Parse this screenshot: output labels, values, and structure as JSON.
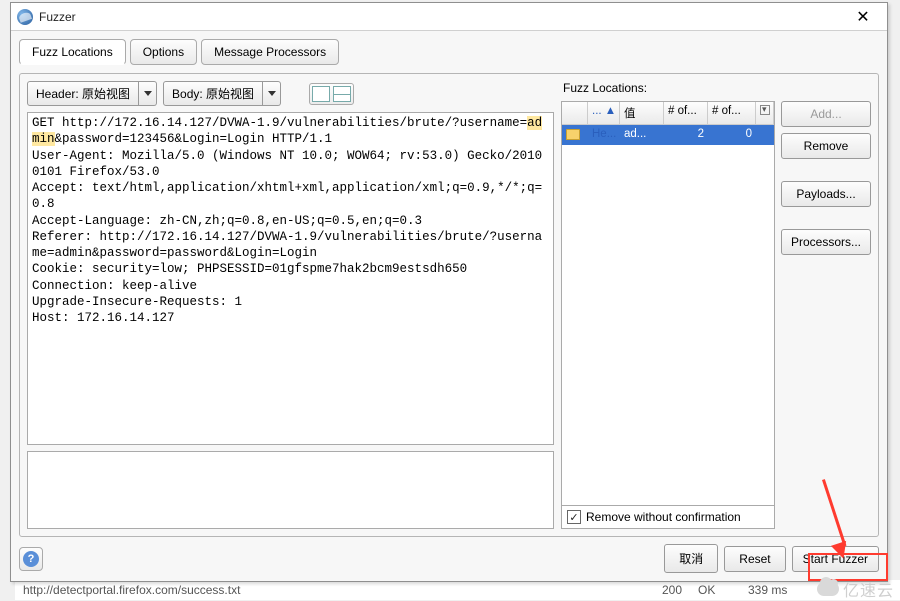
{
  "window": {
    "title": "Fuzzer",
    "close_glyph": "✕"
  },
  "tabs": [
    {
      "id": "fuzz-locations",
      "label": "Fuzz Locations",
      "active": true
    },
    {
      "id": "options",
      "label": "Options",
      "active": false
    },
    {
      "id": "message-processors",
      "label": "Message Processors",
      "active": false
    }
  ],
  "view_bar": {
    "header_label": "Header: 原始视图",
    "body_label": "Body: 原始视图"
  },
  "request": {
    "line1": "GET http://172.16.14.127/DVWA-1.9/vulnerabilities/brute/?username=",
    "highlight": "admin",
    "line1_tail": "&password=123456&Login=Login HTTP/1.1",
    "rest": "User-Agent: Mozilla/5.0 (Windows NT 10.0; WOW64; rv:53.0) Gecko/20100101 Firefox/53.0\nAccept: text/html,application/xhtml+xml,application/xml;q=0.9,*/*;q=0.8\nAccept-Language: zh-CN,zh;q=0.8,en-US;q=0.5,en;q=0.3\nReferer: http://172.16.14.127/DVWA-1.9/vulnerabilities/brute/?username=admin&password=password&Login=Login\nCookie: security=low; PHPSESSID=01gfspme7hak2bcm9estsdh650\nConnection: keep-alive\nUpgrade-Insecure-Requests: 1\nHost: 172.16.14.127"
  },
  "fuzz_panel": {
    "title": "Fuzz Locations:",
    "columns": {
      "c1": "... ▲",
      "c2": "值",
      "c3": "# of...",
      "c4": "# of..."
    },
    "row": {
      "type": "He...",
      "value": "ad...",
      "n1": "2",
      "n2": "0"
    },
    "confirm_label": "Remove without confirmation",
    "confirm_checked": true
  },
  "buttons": {
    "add": "Add...",
    "remove": "Remove",
    "payloads": "Payloads...",
    "processors": "Processors..."
  },
  "footer": {
    "cancel": "取消",
    "reset": "Reset",
    "start": "Start Fuzzer"
  },
  "bg_row": {
    "url": "http://detectportal.firefox.com/success.txt",
    "status": "200",
    "reason": "OK",
    "time": "339 ms"
  },
  "watermark": "亿速云"
}
